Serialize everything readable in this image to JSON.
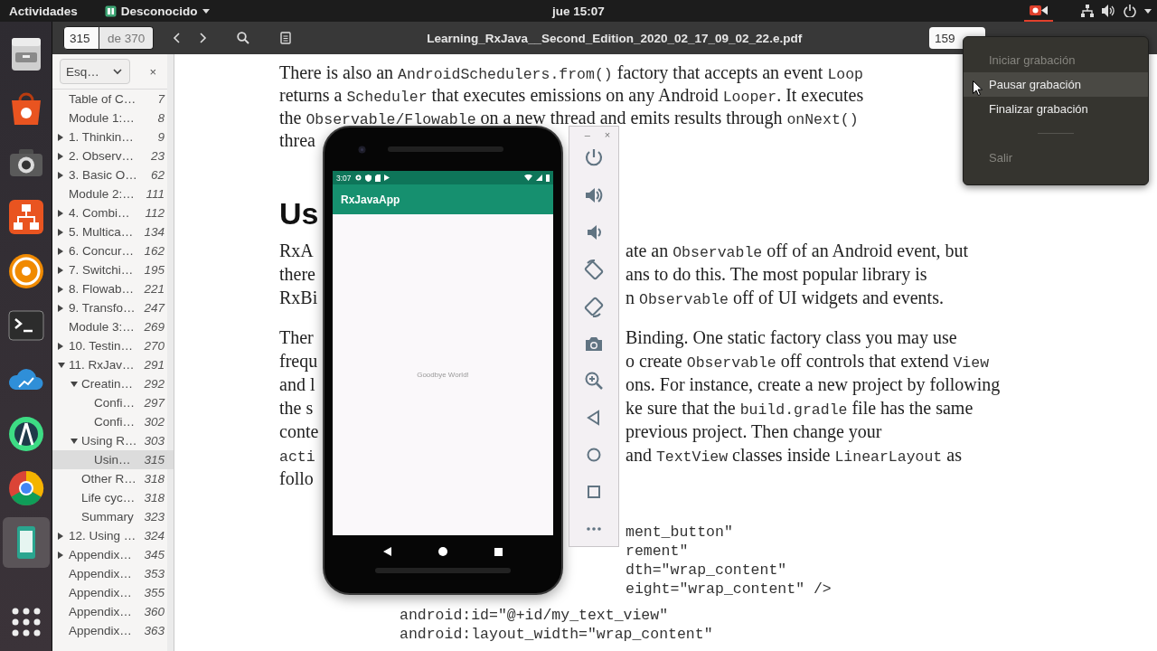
{
  "top_bar": {
    "activities": "Actividades",
    "app_name": "Desconocido",
    "clock": "jue 15:07"
  },
  "dock": {
    "items": [
      {
        "selected": false
      },
      {
        "selected": false
      },
      {
        "selected": false
      },
      {
        "selected": false
      },
      {
        "selected": false
      },
      {
        "selected": false
      },
      {
        "selected": false
      },
      {
        "selected": false
      },
      {
        "selected": false
      },
      {
        "selected": true
      },
      {
        "selected": false
      }
    ]
  },
  "viewer": {
    "page": "315",
    "page_count": "de 370",
    "title": "Learning_RxJava__Second_Edition_2020_02_17_09_02_22.e.pdf",
    "zoom": "159"
  },
  "outline": {
    "mode": "Esq…",
    "close": "×",
    "items": [
      {
        "label": "Table of C…",
        "page": "7",
        "selected": false
      },
      {
        "label": "Module 1:…",
        "page": "8",
        "selected": false
      },
      {
        "label": "1. Thinkin…",
        "page": "9",
        "expanded": false,
        "selected": false
      },
      {
        "label": "2. Observ…",
        "page": "23",
        "expanded": false,
        "selected": false
      },
      {
        "label": "3. Basic O…",
        "page": "62",
        "expanded": false,
        "selected": false
      },
      {
        "label": "Module 2:…",
        "page": "111",
        "selected": false
      },
      {
        "label": "4. Combi…",
        "page": "112",
        "expanded": false,
        "selected": false
      },
      {
        "label": "5. Multica…",
        "page": "134",
        "expanded": false,
        "selected": false
      },
      {
        "label": "6. Concur…",
        "page": "162",
        "expanded": false,
        "selected": false
      },
      {
        "label": "7. Switchi…",
        "page": "195",
        "expanded": false,
        "selected": false
      },
      {
        "label": "8. Flowab…",
        "page": "221",
        "expanded": false,
        "selected": false
      },
      {
        "label": "9. Transfo…",
        "page": "247",
        "expanded": false,
        "selected": false
      },
      {
        "label": "Module 3:…",
        "page": "269",
        "selected": false
      },
      {
        "label": "10. Testin…",
        "page": "270",
        "expanded": false,
        "selected": false
      },
      {
        "label": "11. RxJav…",
        "page": "291",
        "expanded": true,
        "selected": false,
        "children": [
          {
            "label": "Creatin…",
            "page": "292",
            "expanded": true,
            "selected": false,
            "children": [
              {
                "label": "Confi…",
                "page": "297",
                "selected": false
              },
              {
                "label": "Confi…",
                "page": "302",
                "selected": false
              }
            ]
          },
          {
            "label": "Using R…",
            "page": "303",
            "expanded": true,
            "selected": false,
            "children": [
              {
                "label": "Usin…",
                "page": "315",
                "selected": true
              }
            ]
          },
          {
            "label": "Other R…",
            "page": "318",
            "selected": false
          },
          {
            "label": "Life cyc…",
            "page": "318",
            "selected": false
          },
          {
            "label": "Summary",
            "page": "323",
            "selected": false
          }
        ]
      },
      {
        "label": "12. Using …",
        "page": "324",
        "expanded": false,
        "selected": false
      },
      {
        "label": "Appendix…",
        "page": "345",
        "expanded": false,
        "selected": false
      },
      {
        "label": "Appendix…",
        "page": "353",
        "selected": false
      },
      {
        "label": "Appendix…",
        "page": "355",
        "selected": false
      },
      {
        "label": "Appendix…",
        "page": "360",
        "selected": false
      },
      {
        "label": "Appendix…",
        "page": "363",
        "selected": false
      }
    ]
  },
  "document": {
    "blocks": [
      {
        "kind": "text",
        "lines": [
          {
            "full": [
              {
                "text": "There is also an ",
                "code": false
              },
              {
                "text": "AndroidSchedulers.from()",
                "code": true
              },
              {
                "text": " factory that accepts an event ",
                "code": false
              },
              {
                "text": "Loop",
                "code": true
              }
            ]
          },
          {
            "full": [
              {
                "text": "returns a ",
                "code": false
              },
              {
                "text": "Scheduler",
                "code": true
              },
              {
                "text": " that executes emissions on any Android ",
                "code": false
              },
              {
                "text": "Looper",
                "code": true
              },
              {
                "text": ". It executes",
                "code": false
              }
            ]
          },
          {
            "full": [
              {
                "text": "the ",
                "code": false
              },
              {
                "text": "Observable/Flowable",
                "code": true
              },
              {
                "text": " on a new thread and emits results through ",
                "code": false
              },
              {
                "text": "onNext()",
                "code": true
              }
            ]
          },
          {
            "left": [
              {
                "text": "threa",
                "code": false
              }
            ]
          }
        ]
      },
      {
        "kind": "heading",
        "text": "Us"
      },
      {
        "kind": "text",
        "lines": [
          {
            "left": [
              {
                "text": "RxA",
                "code": false
              }
            ],
            "right": [
              {
                "text": "ate an ",
                "code": false
              },
              {
                "text": "Observable",
                "code": true
              },
              {
                "text": " off of an Android event, but",
                "code": false
              }
            ]
          },
          {
            "left": [
              {
                "text": "there",
                "code": false
              }
            ],
            "right": [
              {
                "text": "ans to do this. The most popular library is",
                "code": false
              }
            ]
          },
          {
            "left": [
              {
                "text": "RxBi",
                "code": false
              }
            ],
            "right": [
              {
                "text": "n ",
                "code": false
              },
              {
                "text": "Observable",
                "code": true
              },
              {
                "text": " off of UI widgets and events.",
                "code": false
              }
            ]
          }
        ]
      },
      {
        "kind": "text",
        "lines": [
          {
            "left": [
              {
                "text": "Ther",
                "code": false
              }
            ],
            "right": [
              {
                "text": "Binding. One static factory class you may use",
                "code": false
              }
            ]
          },
          {
            "left": [
              {
                "text": "frequ",
                "code": false
              }
            ],
            "right": [
              {
                "text": "o create ",
                "code": false
              },
              {
                "text": "Observable",
                "code": true
              },
              {
                "text": " off controls that extend ",
                "code": false
              },
              {
                "text": "View",
                "code": true
              }
            ]
          },
          {
            "left": [
              {
                "text": "and l",
                "code": false
              }
            ],
            "right": [
              {
                "text": "ons. For instance, create a new project by following",
                "code": false
              }
            ]
          },
          {
            "left": [
              {
                "text": "the s",
                "code": false
              }
            ],
            "right": [
              {
                "text": "ke sure that the ",
                "code": false
              },
              {
                "text": "build.gradle",
                "code": true
              },
              {
                "text": " file has the same",
                "code": false
              }
            ]
          },
          {
            "left": [
              {
                "text": "conte",
                "code": false
              }
            ],
            "right": [
              {
                "text": "previous project. Then change your",
                "code": false
              }
            ]
          },
          {
            "left": [
              {
                "text": "acti",
                "code": true
              }
            ],
            "right": [
              {
                "text": "and ",
                "code": false
              },
              {
                "text": "TextView",
                "code": true
              },
              {
                "text": " classes inside ",
                "code": false
              },
              {
                "text": "LinearLayout",
                "code": true
              },
              {
                "text": " as",
                "code": false
              }
            ]
          },
          {
            "left": [
              {
                "text": "follo",
                "code": false
              }
            ]
          }
        ]
      },
      {
        "kind": "code",
        "lines": [
          {
            "right": "ment_button\""
          },
          {
            "right": "rement\""
          },
          {
            "right": "dth=\"wrap_content\""
          },
          {
            "right": "eight=\"wrap_content\" />"
          }
        ]
      },
      {
        "kind": "code",
        "lines": [
          {
            "full": "android:id=\"@+id/my_text_view\""
          },
          {
            "full": "android:layout_width=\"wrap_content\""
          }
        ]
      }
    ]
  },
  "emulator": {
    "status_time": "3:07",
    "app_title": "RxJavaApp",
    "message": "Goodbye World!",
    "minimize": "–",
    "close": "×"
  },
  "record_menu": {
    "items": [
      {
        "kind": "item",
        "label": "Iniciar grabación",
        "disabled": true,
        "selected": false
      },
      {
        "kind": "item",
        "label": "Pausar grabación",
        "disabled": false,
        "selected": true
      },
      {
        "kind": "item",
        "label": "Finalizar grabación",
        "disabled": false,
        "selected": false
      },
      {
        "kind": "separator"
      },
      {
        "kind": "item",
        "label": "Salir",
        "disabled": true,
        "selected": false
      }
    ]
  }
}
